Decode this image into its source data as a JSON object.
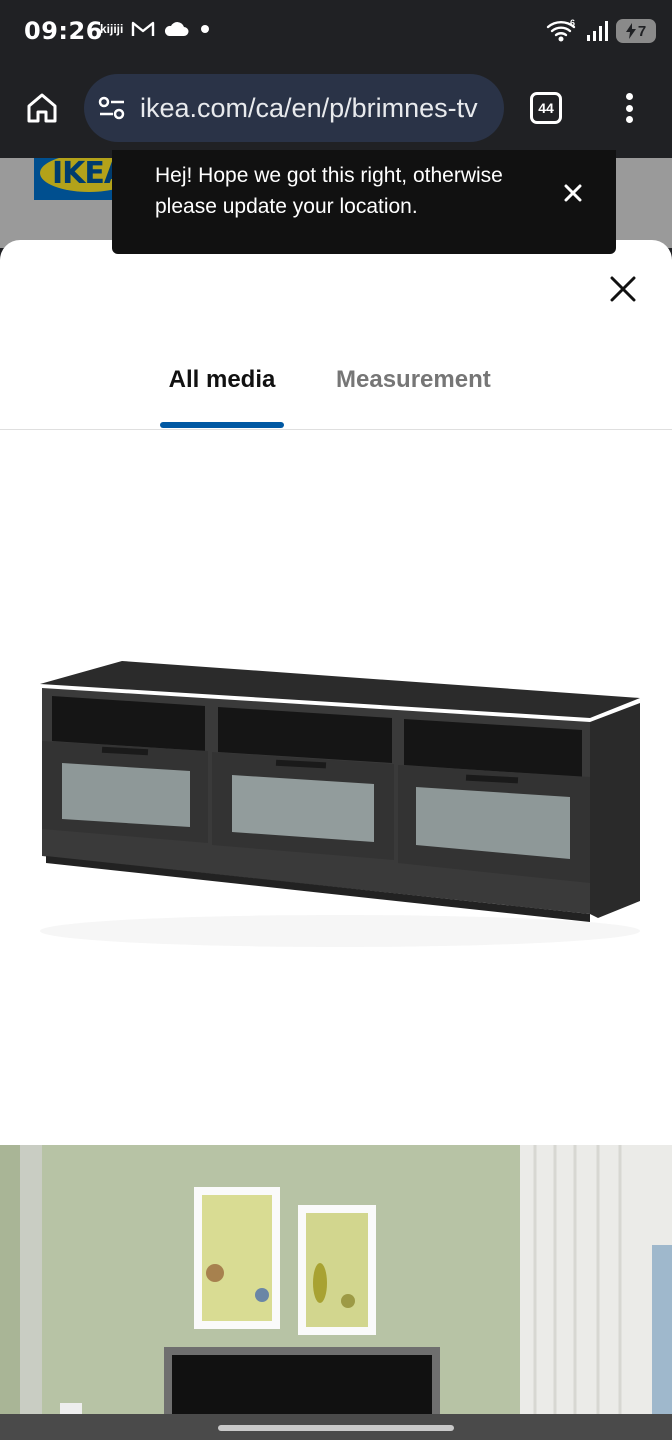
{
  "status_bar": {
    "time": "09:26",
    "kijiji_label": "kijiji",
    "battery_level": "7",
    "icons": [
      "kijiji-icon",
      "gmail-icon",
      "cloud-icon",
      "dot-icon",
      "wifi-icon",
      "signal-icon",
      "battery-icon"
    ],
    "wifi_badge": "6"
  },
  "browser": {
    "url": "ikea.com/ca/en/p/brimnes-tv",
    "tab_count": "44",
    "icons": [
      "home-icon",
      "site-settings-icon",
      "tabs-icon",
      "more-menu-icon"
    ]
  },
  "page_behind": {
    "logo_text": "IKEA"
  },
  "toast": {
    "message": "Hej! Hope we got this right, otherwise please update your location.",
    "close_icon": "close-icon"
  },
  "media_sheet": {
    "tabs": [
      {
        "label": "All media",
        "active": true
      },
      {
        "label": "Measurement",
        "active": false
      }
    ],
    "accent_color": "#0058a3"
  },
  "nav_bar": {
    "handle": "gesture-handle"
  }
}
